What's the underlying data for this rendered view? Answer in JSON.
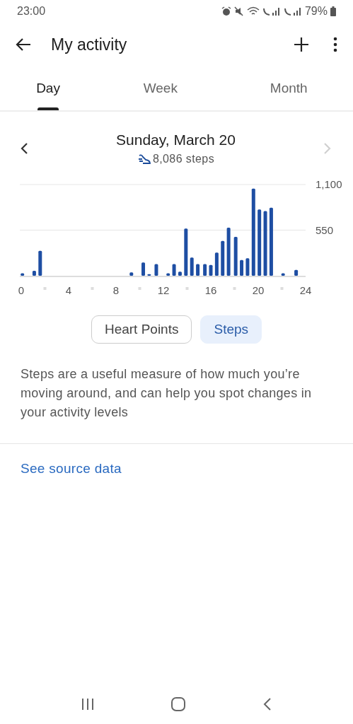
{
  "status_bar": {
    "time": "23:00",
    "battery": "79%"
  },
  "app_bar": {
    "title": "My activity"
  },
  "tabs": [
    {
      "label": "Day",
      "selected": true
    },
    {
      "label": "Week",
      "selected": false
    },
    {
      "label": "Month",
      "selected": false
    }
  ],
  "day": {
    "date": "Sunday, March 20",
    "summary": "8,086 steps",
    "next_disabled": true
  },
  "chart": {
    "chart_data": {
      "type": "bar",
      "x": [
        0.1,
        1.1,
        1.6,
        9.3,
        10.3,
        10.8,
        11.4,
        12.4,
        12.9,
        13.4,
        13.9,
        14.4,
        14.9,
        15.5,
        16.0,
        16.5,
        17.0,
        17.5,
        18.1,
        18.6,
        19.1,
        19.6,
        20.1,
        20.6,
        21.1,
        22.1,
        23.2
      ],
      "values": [
        30,
        60,
        300,
        40,
        160,
        20,
        140,
        30,
        140,
        50,
        570,
        220,
        140,
        140,
        130,
        280,
        420,
        580,
        470,
        190,
        210,
        1050,
        800,
        780,
        820,
        30,
        70
      ],
      "xlim": [
        0,
        24
      ],
      "ylim": [
        0,
        1100
      ],
      "xticks": [
        0,
        4,
        8,
        12,
        16,
        20,
        24
      ],
      "yticks": [
        {
          "value": 550,
          "label": "550"
        },
        {
          "value": 1100,
          "label": "1,100"
        }
      ]
    }
  },
  "metric_toggle": [
    {
      "label": "Heart Points",
      "selected": false
    },
    {
      "label": "Steps",
      "selected": true
    }
  ],
  "description": "Steps are a useful measure of how much you’re moving around, and can help you spot changes in your activity levels",
  "source_link": "See source data"
}
